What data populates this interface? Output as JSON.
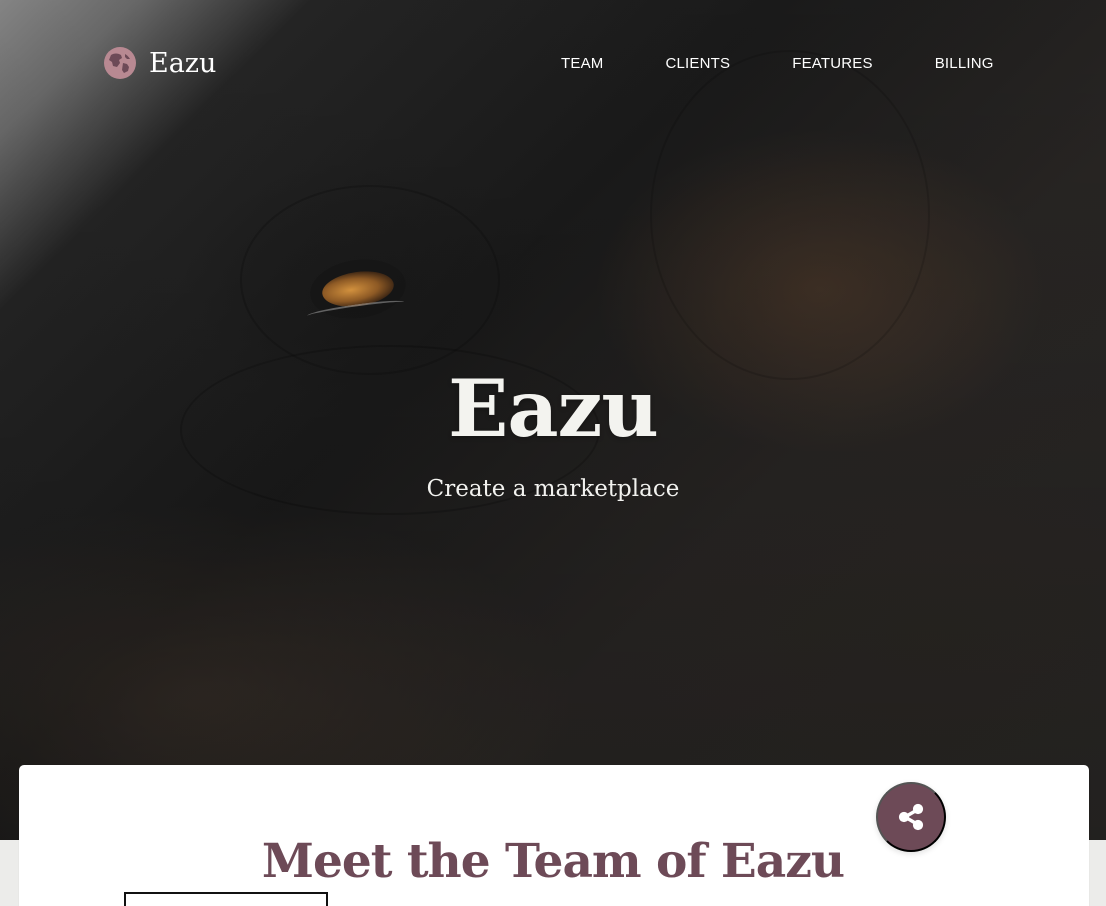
{
  "brand": {
    "name": "Eazu",
    "icon": "globe-icon"
  },
  "navigation": {
    "items": [
      {
        "label": "TEAM"
      },
      {
        "label": "CLIENTS"
      },
      {
        "label": "FEATURES"
      },
      {
        "label": "BILLING"
      }
    ]
  },
  "hero": {
    "title": "Eazu",
    "subtitle": "Create a marketplace"
  },
  "team_section": {
    "title": "Meet the Team of Eazu",
    "share_icon": "share-icon"
  },
  "colors": {
    "accent": "#6d4a57",
    "hero_text": "#f3f3ef",
    "card_bg": "#ffffff",
    "page_bg": "#ececea"
  }
}
